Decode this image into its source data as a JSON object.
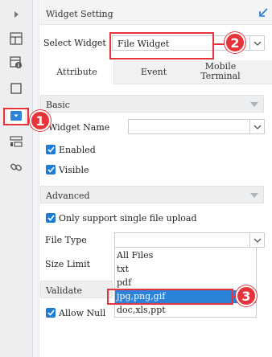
{
  "panel": {
    "title": "Widget Setting",
    "select_widget_label": "Select Widget",
    "select_widget_value": "File Widget"
  },
  "tabs": [
    {
      "label": "Attribute",
      "active": true
    },
    {
      "label": "Event",
      "active": false
    },
    {
      "label": "Mobile Terminal",
      "active": false
    }
  ],
  "basic": {
    "section_label": "Basic",
    "widget_name_label": "Widget Name",
    "widget_name_value": "",
    "enabled_label": "Enabled",
    "enabled_checked": true,
    "visible_label": "Visible",
    "visible_checked": true
  },
  "advanced": {
    "section_label": "Advanced",
    "single_upload_label": "Only support single file upload",
    "single_upload_checked": true,
    "file_type_label": "File Type",
    "file_type_value": "",
    "size_limit_label": "Size Limit"
  },
  "file_type_options": [
    "All Files",
    "txt",
    "pdf",
    "jpg,png,gif",
    "doc,xls,ppt"
  ],
  "file_type_highlighted": "jpg,png,gif",
  "validate": {
    "section_label": "Validate",
    "allow_null_label": "Allow Null",
    "allow_null_checked": true
  },
  "callouts": [
    "1",
    "2",
    "3"
  ],
  "toolbar_icons": [
    "expand-arrow-icon",
    "layout-grid-icon",
    "widget-info-icon",
    "frame-icon",
    "dropdown-widget-icon",
    "list-widget-icon",
    "link-icon"
  ],
  "colors": {
    "accent": "#1e7bd6",
    "highlight": "#e8333b",
    "selected_option": "#2a83d8"
  }
}
